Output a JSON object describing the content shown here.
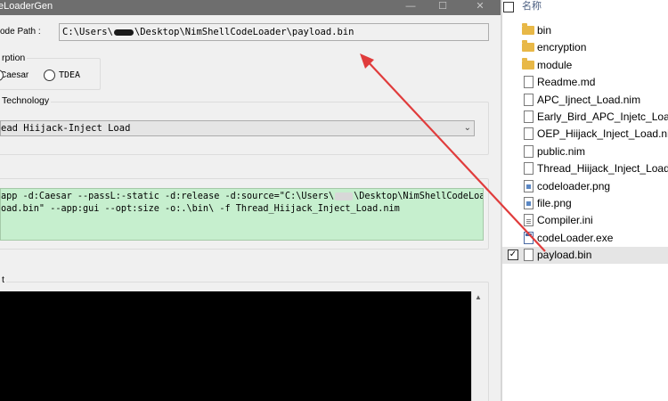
{
  "window": {
    "title": "eLoaderGen",
    "minimize_glyph": "—",
    "maximize_glyph": "☐",
    "close_glyph": "✕"
  },
  "shellcode_path": {
    "label": "ode Path :",
    "value_before": "C:\\Users\\",
    "value_after": "\\Desktop\\NimShellCodeLoader\\payload.bin"
  },
  "encryption": {
    "caption": "rption",
    "options": [
      {
        "label": "Caesar",
        "selected": true
      },
      {
        "label": "TDEA",
        "selected": false
      }
    ]
  },
  "technology": {
    "caption": "Technology",
    "selected": "ead Hiijack-Inject Load",
    "arrow_icon": "chevron-down-icon"
  },
  "command": {
    "line1_before": "app -d:Caesar --passL:-static -d:release -d:source=\"C:\\Users\\",
    "line1_after": "\\Desktop\\NimShellCodeLoader",
    "line2": "oad.bin\" --app:gui --opt:size -o:.\\bin\\ -f Thread_Hiijack_Inject_Load.nim"
  },
  "output": {
    "caption": "t",
    "scroll_up_glyph": "▲"
  },
  "explorer": {
    "header": "名称",
    "files": [
      {
        "name": "bin",
        "type": "folder",
        "checked": false,
        "selected": false
      },
      {
        "name": "encryption",
        "type": "folder",
        "checked": false,
        "selected": false
      },
      {
        "name": "module",
        "type": "folder",
        "checked": false,
        "selected": false
      },
      {
        "name": "Readme.md",
        "type": "doc",
        "checked": false,
        "selected": false
      },
      {
        "name": "APC_Ijnect_Load.nim",
        "type": "doc",
        "checked": false,
        "selected": false
      },
      {
        "name": "Early_Bird_APC_Injetc_Load.",
        "type": "doc",
        "checked": false,
        "selected": false
      },
      {
        "name": "OEP_Hiijack_Inject_Load.nim",
        "type": "doc",
        "checked": false,
        "selected": false
      },
      {
        "name": "public.nim",
        "type": "doc",
        "checked": false,
        "selected": false
      },
      {
        "name": "Thread_Hiijack_Inject_Load.n",
        "type": "doc",
        "checked": false,
        "selected": false
      },
      {
        "name": "codeloader.png",
        "type": "img",
        "checked": false,
        "selected": false
      },
      {
        "name": "file.png",
        "type": "img",
        "checked": false,
        "selected": false
      },
      {
        "name": "Compiler.ini",
        "type": "ini",
        "checked": false,
        "selected": false
      },
      {
        "name": "codeLoader.exe",
        "type": "exe",
        "checked": false,
        "selected": false
      },
      {
        "name": "payload.bin",
        "type": "doc",
        "checked": true,
        "selected": true
      }
    ],
    "check_glyph": "✓"
  },
  "colors": {
    "command_bg": "#c6efce",
    "annotation_arrow": "#e03c3c",
    "titlebar": "#6e6e6e"
  }
}
